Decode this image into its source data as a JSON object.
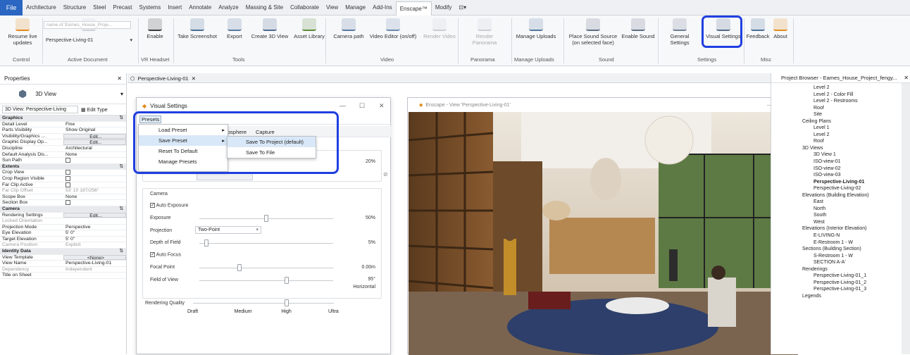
{
  "menu": {
    "file": "File",
    "items": [
      "Architecture",
      "Structure",
      "Steel",
      "Precast",
      "Systems",
      "Insert",
      "Annotate",
      "Analyze",
      "Massing & Site",
      "Collaborate",
      "View",
      "Manage",
      "Add-Ins",
      "Enscape™",
      "Modify",
      "⊡▾"
    ],
    "active": "Enscape™"
  },
  "ribbon": {
    "buttons": [
      {
        "label": "Resume live updates",
        "icon": "enscape-logo-icon"
      },
      {
        "label": "Perspective-Living-01",
        "icon": "document-dropdown-icon"
      },
      {
        "label": "Enable",
        "icon": "vr-headset-icon"
      },
      {
        "label": "Take Screenshot",
        "icon": "screenshot-icon"
      },
      {
        "label": "Export",
        "icon": "export-icon"
      },
      {
        "label": "Create 3D View",
        "icon": "create-3d-view-icon"
      },
      {
        "label": "Asset Library",
        "icon": "asset-library-icon"
      },
      {
        "label": "Camera path",
        "icon": "camera-path-icon"
      },
      {
        "label": "Video Editor (on/off)",
        "icon": "video-editor-icon"
      },
      {
        "label": "Render Video",
        "icon": "render-video-icon"
      },
      {
        "label": "Render Panorama",
        "icon": "render-panorama-icon"
      },
      {
        "label": "Manage Uploads",
        "icon": "manage-uploads-icon"
      },
      {
        "label": "Place Sound Source (on selected face)",
        "icon": "sound-source-icon"
      },
      {
        "label": "Enable Sound",
        "icon": "enable-sound-icon"
      },
      {
        "label": "General Settings",
        "icon": "general-settings-icon"
      },
      {
        "label": "Visual Settings",
        "icon": "visual-settings-icon"
      },
      {
        "label": "Feedback",
        "icon": "feedback-icon"
      },
      {
        "label": "About",
        "icon": "about-icon"
      }
    ],
    "active_document_placeholder": "name of 'Eames_House_Proje...",
    "groups": [
      "Control",
      "Active Document",
      "VR Headset",
      "Tools",
      "Video",
      "Panorama",
      "Manage Uploads",
      "Sound",
      "Settings",
      "Misc"
    ]
  },
  "properties": {
    "title": "Properties",
    "type_name": "3D View",
    "selector": "3D View: Perspective-Living",
    "edit_type": "Edit Type",
    "rows": [
      {
        "k": "Graphics",
        "v": "",
        "sec": true
      },
      {
        "k": "Detail Level",
        "v": "Fine"
      },
      {
        "k": "Parts Visibility",
        "v": "Show Original"
      },
      {
        "k": "Visibility/Graphics ...",
        "v": "Edit...",
        "btn": true
      },
      {
        "k": "Graphic Display Op...",
        "v": "Edit...",
        "btn": true
      },
      {
        "k": "Discipline",
        "v": "Architectural"
      },
      {
        "k": "Default Analysis Dis...",
        "v": "None"
      },
      {
        "k": "Sun Path",
        "v": "",
        "cb": true
      },
      {
        "k": "Extents",
        "v": "",
        "sec": true
      },
      {
        "k": "Crop View",
        "v": "",
        "cb": true
      },
      {
        "k": "Crop Region Visible",
        "v": "",
        "cb": true
      },
      {
        "k": "Far Clip Active",
        "v": "",
        "cb": true
      },
      {
        "k": "Far Clip Offset",
        "v": "53' 10 187/256\"",
        "dim": true
      },
      {
        "k": "Scope Box",
        "v": "None"
      },
      {
        "k": "Section Box",
        "v": "",
        "cb": true
      },
      {
        "k": "Camera",
        "v": "",
        "sec": true
      },
      {
        "k": "Rendering Settings",
        "v": "Edit...",
        "btn": true
      },
      {
        "k": "Locked Orientation",
        "v": "",
        "dim": true
      },
      {
        "k": "Projection Mode",
        "v": "Perspective"
      },
      {
        "k": "Eye Elevation",
        "v": "5' 0\""
      },
      {
        "k": "Target Elevation",
        "v": "5' 0\""
      },
      {
        "k": "Camera Position",
        "v": "Explicit",
        "dim": true
      },
      {
        "k": "Identity Data",
        "v": "",
        "sec": true
      },
      {
        "k": "View Template",
        "v": "<None>",
        "btn": true
      },
      {
        "k": "View Name",
        "v": "Perspective-Living-01"
      },
      {
        "k": "Dependency",
        "v": "Independent",
        "dim": true
      },
      {
        "k": "Title on Sheet",
        "v": ""
      }
    ]
  },
  "view_tab": "Perspective-Living-01",
  "visual_settings": {
    "title": "Visual Settings",
    "menu_presets": "Presets",
    "tabs_partial": [
      "osphere",
      "Capture"
    ],
    "top_value": "20%",
    "camera_section": "Camera",
    "auto_exposure": "Auto Exposure",
    "exposure_label": "Exposure",
    "exposure_value": "50%",
    "exposure_pos": 0.5,
    "projection_label": "Projection",
    "projection_value": "Two-Point",
    "dof_label": "Depth of Field",
    "dof_value": "5%",
    "dof_pos": 0.05,
    "auto_focus": "Auto Focus",
    "focal_label": "Focal Point",
    "focal_value": "0.00m",
    "focal_pos": 0.3,
    "fov_label": "Field of View",
    "fov_value": "95°",
    "fov_sub": "Horizontal",
    "fov_pos": 0.65,
    "rq_label": "Rendering Quality",
    "rq_ticks": [
      "Draft",
      "Medium",
      "High",
      "Ultra"
    ],
    "rq_pos": 0.667
  },
  "presets_menu": {
    "items": [
      "Load Preset",
      "Save Preset",
      "Reset To Default",
      "Manage Presets"
    ],
    "save_sub": [
      "Save To Project (default)",
      "Save To File"
    ]
  },
  "enscape_window": {
    "title": "Enscape - View 'Perspective-Living-01'"
  },
  "browser": {
    "title": "Project Browser - Eames_House_Project_fengy...",
    "items": [
      {
        "t": "Level 2",
        "l": 2
      },
      {
        "t": "Level 2 - Color Fill",
        "l": 2
      },
      {
        "t": "Level 2 - Restrooms",
        "l": 2
      },
      {
        "t": "Roof",
        "l": 2
      },
      {
        "t": "Site",
        "l": 2
      },
      {
        "t": "Ceiling Plans",
        "l": 1
      },
      {
        "t": "Level 1",
        "l": 2
      },
      {
        "t": "Level 2",
        "l": 2
      },
      {
        "t": "Roof",
        "l": 2
      },
      {
        "t": "3D Views",
        "l": 1
      },
      {
        "t": "3D View 1",
        "l": 2
      },
      {
        "t": "ISO-view-01",
        "l": 2
      },
      {
        "t": "ISO-view-02",
        "l": 2
      },
      {
        "t": "ISO-view-03",
        "l": 2
      },
      {
        "t": "Perspective-Living-01",
        "l": 2,
        "bold": true
      },
      {
        "t": "Perspective-Living-02",
        "l": 2
      },
      {
        "t": "Elevations (Building Elevation)",
        "l": 1
      },
      {
        "t": "East",
        "l": 2
      },
      {
        "t": "North",
        "l": 2
      },
      {
        "t": "South",
        "l": 2
      },
      {
        "t": "West",
        "l": 2
      },
      {
        "t": "Elevations (Interior Elevation)",
        "l": 1
      },
      {
        "t": "E-LIVING-N",
        "l": 2
      },
      {
        "t": "E-Restroom 1 - W",
        "l": 2
      },
      {
        "t": "Sections (Building Section)",
        "l": 1
      },
      {
        "t": "S-Restroom 1 - W",
        "l": 2
      },
      {
        "t": "SECTION A-A'",
        "l": 2
      },
      {
        "t": "Renderings",
        "l": 1
      },
      {
        "t": "Perspective-Living-01_1",
        "l": 2
      },
      {
        "t": "Perspective-Living-01_2",
        "l": 2
      },
      {
        "t": "Perspective-Living-01_3",
        "l": 2
      },
      {
        "t": "Legends",
        "l": 1
      }
    ]
  }
}
